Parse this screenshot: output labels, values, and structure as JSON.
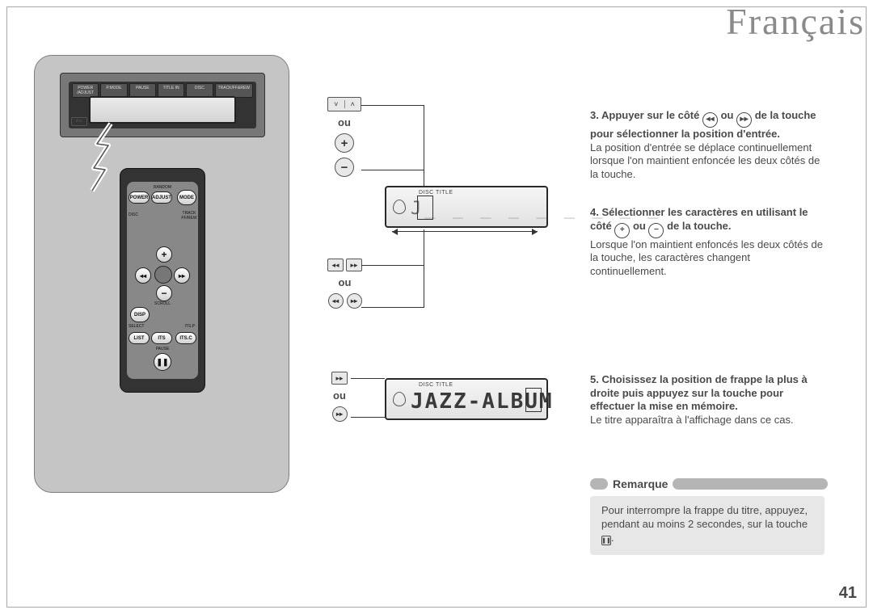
{
  "header": {
    "title": "Français"
  },
  "labels": {
    "ou": "ou"
  },
  "device_top": {
    "buttons": [
      "POWER /ADJUST",
      "P.MODE",
      "PAUSE",
      "TITLE IN",
      "DISC",
      "TRACK/FF&REW"
    ]
  },
  "remote": {
    "row1": {
      "random": "RANDOM",
      "power": "POWER",
      "adjust": "ADJUST",
      "mode": "MODE"
    },
    "dpad": {
      "disc": "DISC",
      "track": "TRACK FF/REW",
      "scroll": "SCROLL"
    },
    "row3": {
      "select": "SELECT",
      "itsp": "ITS.P",
      "disp": "DISP"
    },
    "row4": {
      "list": "LIST",
      "its": "ITS",
      "itsc": "ITS.C"
    },
    "pause": "PAUSE"
  },
  "set1": {
    "top_pair": [
      "˅",
      "˄"
    ]
  },
  "lcd1": {
    "disc_title": "DISC TITLE",
    "content": "J----------",
    "cursor_char": "J"
  },
  "lcd2": {
    "disc_title": "DISC TITLE",
    "content": "JAZZ-ALBUM"
  },
  "step3": {
    "num": "3.",
    "bold_a": "Appuyer sur le côté ",
    "bold_b": " ou ",
    "bold_c": " de la touche pour sélectionner la posi­tion d'entrée.",
    "body": "La position d'entrée se déplace conti­nuellement lorsque l'on maintient enfoncée les deux côtés de la touche."
  },
  "step4": {
    "num": "4.",
    "bold_a": "Sélectionner les caractères en uti­lisant le côté ",
    "bold_b": " ou ",
    "bold_c": " de la touche.",
    "body": "Lorsque l'on maintient enfoncés les deux côtés de la touche, les caractères changent continuellement."
  },
  "step5": {
    "num": "5.",
    "bold": "Choisissez la position de frappe la plus à droite puis appuyez sur la touche pour effectuer la mise en mémoire.",
    "body": "Le titre apparaîtra à l'affichage dans ce cas."
  },
  "remarque": {
    "label": "Remarque"
  },
  "note": {
    "text_a": "Pour interrompre la frappe du titre, appuyez, pendant au moins 2 secon­des, sur la touche ",
    "text_b": "."
  },
  "page_number": "41"
}
